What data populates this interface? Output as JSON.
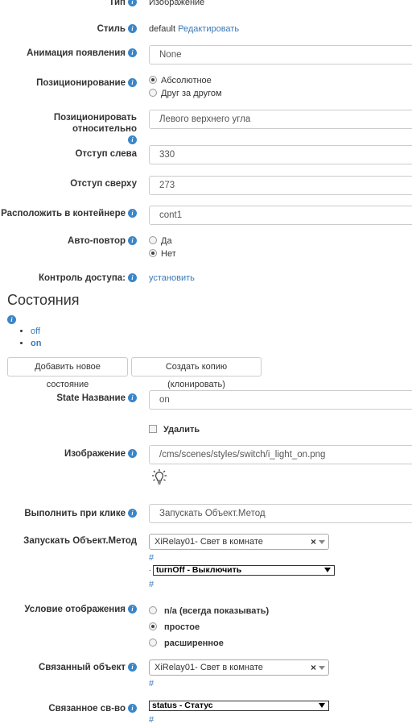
{
  "fields": {
    "type": {
      "label": "Тип",
      "value": "Изображение"
    },
    "style": {
      "label": "Стиль",
      "value": "default",
      "edit_link": "Редактировать"
    },
    "animation": {
      "label": "Анимация появления",
      "value": "None"
    },
    "positioning": {
      "label": "Позиционирование",
      "options": [
        "Абсолютное",
        "Друг за другом"
      ],
      "selected": 0
    },
    "relative": {
      "label": "Позиционировать относительно",
      "value": "Левого верхнего угла"
    },
    "left": {
      "label": "Отступ слева",
      "value": "330"
    },
    "top": {
      "label": "Отступ сверху",
      "value": "273"
    },
    "container": {
      "label": "Расположить в контейнере",
      "value": "cont1"
    },
    "autorepeat": {
      "label": "Авто-повтор",
      "options": [
        "Да",
        "Нет"
      ],
      "selected": 1
    },
    "access": {
      "label": "Контроль доступа:",
      "link": "установить"
    }
  },
  "states_section": {
    "title": "Состояния",
    "items": [
      "off",
      "on"
    ],
    "add_button": "Добавить новое состояние",
    "clone_button": "Создать копию (клонировать)"
  },
  "state": {
    "name": {
      "label": "State Название",
      "value": "on"
    },
    "delete_label": "Удалить",
    "image": {
      "label": "Изображение",
      "value": "/cms/scenes/styles/switch/i_light_on.png"
    },
    "onclick": {
      "label": "Выполнить при клике",
      "value": "Запускать Объект.Метод"
    },
    "run_method": {
      "label": "Запускать Объект.Метод",
      "object": "XiRelay01- Свет в комнате",
      "hash": "#",
      "dot": ".",
      "method": "turnOff - Выключить",
      "hash2": "#"
    },
    "condition": {
      "label": "Условие отображения",
      "options": [
        "n/a (всегда показывать)",
        "простое",
        "расширенное"
      ],
      "selected": 1
    },
    "linked_object": {
      "label": "Связанный объект",
      "value": "XiRelay01- Свет в комнате",
      "hash": "#"
    },
    "linked_property": {
      "label": "Связанное св-во",
      "value": "status - Статус",
      "hash": "#"
    }
  },
  "colors": {
    "accent": "#3a79b8",
    "info_icon": "#3a86c8",
    "border": "#cccccc"
  }
}
